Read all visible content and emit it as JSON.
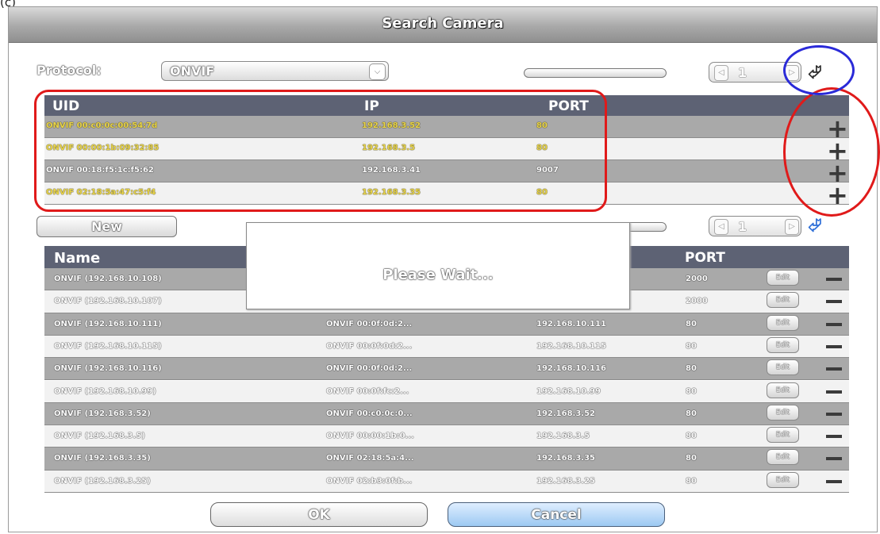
{
  "figure_label": "(c)",
  "window": {
    "title": "Search Camera"
  },
  "protocol": {
    "label": "Protocol:",
    "value": "ONVIF"
  },
  "search_pager": {
    "page": "1"
  },
  "search_table": {
    "columns": [
      "UID",
      "IP",
      "PORT"
    ],
    "rows": [
      {
        "uid": "ONVIF 00:c0:0c:00:54:7d",
        "ip": "192.168.3.52",
        "port": "80",
        "color": "yellow"
      },
      {
        "uid": "ONVIF 00:00:1b:09:32:85",
        "ip": "192.168.3.5",
        "port": "80",
        "color": "yellow"
      },
      {
        "uid": "ONVIF 00:18:f5:1c:f5:62",
        "ip": "192.168.3.41",
        "port": "9007",
        "color": "white"
      },
      {
        "uid": "ONVIF 02:18:5a:47:c5:f4",
        "ip": "192.168.3.35",
        "port": "80",
        "color": "yellow"
      }
    ]
  },
  "new_button": {
    "label": "New"
  },
  "added_pager": {
    "page": "1"
  },
  "added_table": {
    "columns": [
      "Name",
      "PORT"
    ],
    "edit_label": "Edit",
    "rows": [
      {
        "name": "ONVIF (192.168.10.108)",
        "uid": "",
        "ip": "",
        "port": "2000"
      },
      {
        "name": "ONVIF (192.168.10.107)",
        "uid": "",
        "ip": "",
        "port": "2000"
      },
      {
        "name": "ONVIF (192.168.10.111)",
        "uid": "ONVIF 00:0f:0d:2...",
        "ip": "192.168.10.111",
        "port": "80"
      },
      {
        "name": "ONVIF (192.168.10.115)",
        "uid": "ONVIF 00:0f:0d:2...",
        "ip": "192.168.10.115",
        "port": "80"
      },
      {
        "name": "ONVIF (192.168.10.116)",
        "uid": "ONVIF 00:0f:0d:2...",
        "ip": "192.168.10.116",
        "port": "80"
      },
      {
        "name": "ONVIF (192.168.10.99)",
        "uid": "ONVIF 00:0f:fc:2...",
        "ip": "192.168.10.99",
        "port": "80"
      },
      {
        "name": "ONVIF (192.168.3.52)",
        "uid": "ONVIF 00:c0:0c:0...",
        "ip": "192.168.3.52",
        "port": "80"
      },
      {
        "name": "ONVIF (192.168.3.5)",
        "uid": "ONVIF 00:00:1b:0...",
        "ip": "192.168.3.5",
        "port": "80"
      },
      {
        "name": "ONVIF (192.168.3.35)",
        "uid": "ONVIF 02:18:5a:4...",
        "ip": "192.168.3.35",
        "port": "80"
      },
      {
        "name": "ONVIF (192.168.3.25)",
        "uid": "ONVIF 02:b3:0f:b...",
        "ip": "192.168.3.25",
        "port": "80"
      }
    ]
  },
  "dialog": {
    "message": "Please Wait..."
  },
  "buttons": {
    "ok": "OK",
    "cancel": "Cancel"
  },
  "colors": {
    "header_bg": "#5d6274",
    "row_gray": "#a9a9a9",
    "row_light": "#f2f2f2",
    "yellow_text": "#e8d44a",
    "highlight_red": "#e01a1a",
    "highlight_blue": "#2a2ad8",
    "cancel_blue": "#9cc9f2"
  },
  "icons": {
    "add": "plus-icon",
    "remove": "minus-icon",
    "back": "return-arrow-icon",
    "prev": "arrow-left-icon",
    "next": "arrow-right-icon",
    "dropdown": "chevron-down-icon"
  }
}
